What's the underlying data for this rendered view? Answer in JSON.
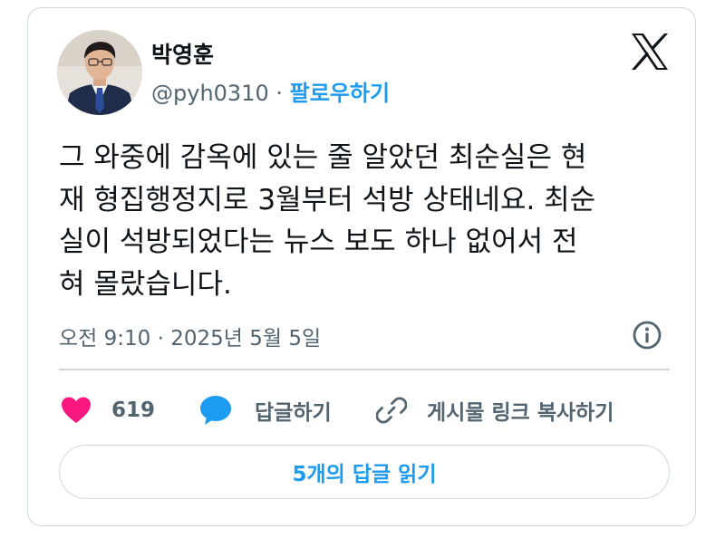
{
  "author": {
    "display_name": "박영훈",
    "handle": "@pyh0310",
    "separator": " · ",
    "follow_label": "팔로우하기",
    "avatar_icon": "avatar-photo"
  },
  "platform_icon": "x-logo-icon",
  "tweet": {
    "text": "그 와중에 감옥에 있는 줄 알았던 최순실은 현\n재 형집행정지로 3월부터 석방 상태네요. 최순\n실이 석방되었다는 뉴스 보도 하나 없어서 전\n혀 몰랐습니다.",
    "timestamp": "오전 9:10 · 2025년 5월 5일"
  },
  "actions": {
    "like_count": "619",
    "reply_label": "답글하기",
    "copy_link_label": "게시물 링크 복사하기"
  },
  "read_replies_label": "5개의 답글 읽기",
  "colors": {
    "accent": "#1d9bf0",
    "like": "#f91880",
    "text_secondary": "#536471",
    "border": "#cfd9de"
  }
}
